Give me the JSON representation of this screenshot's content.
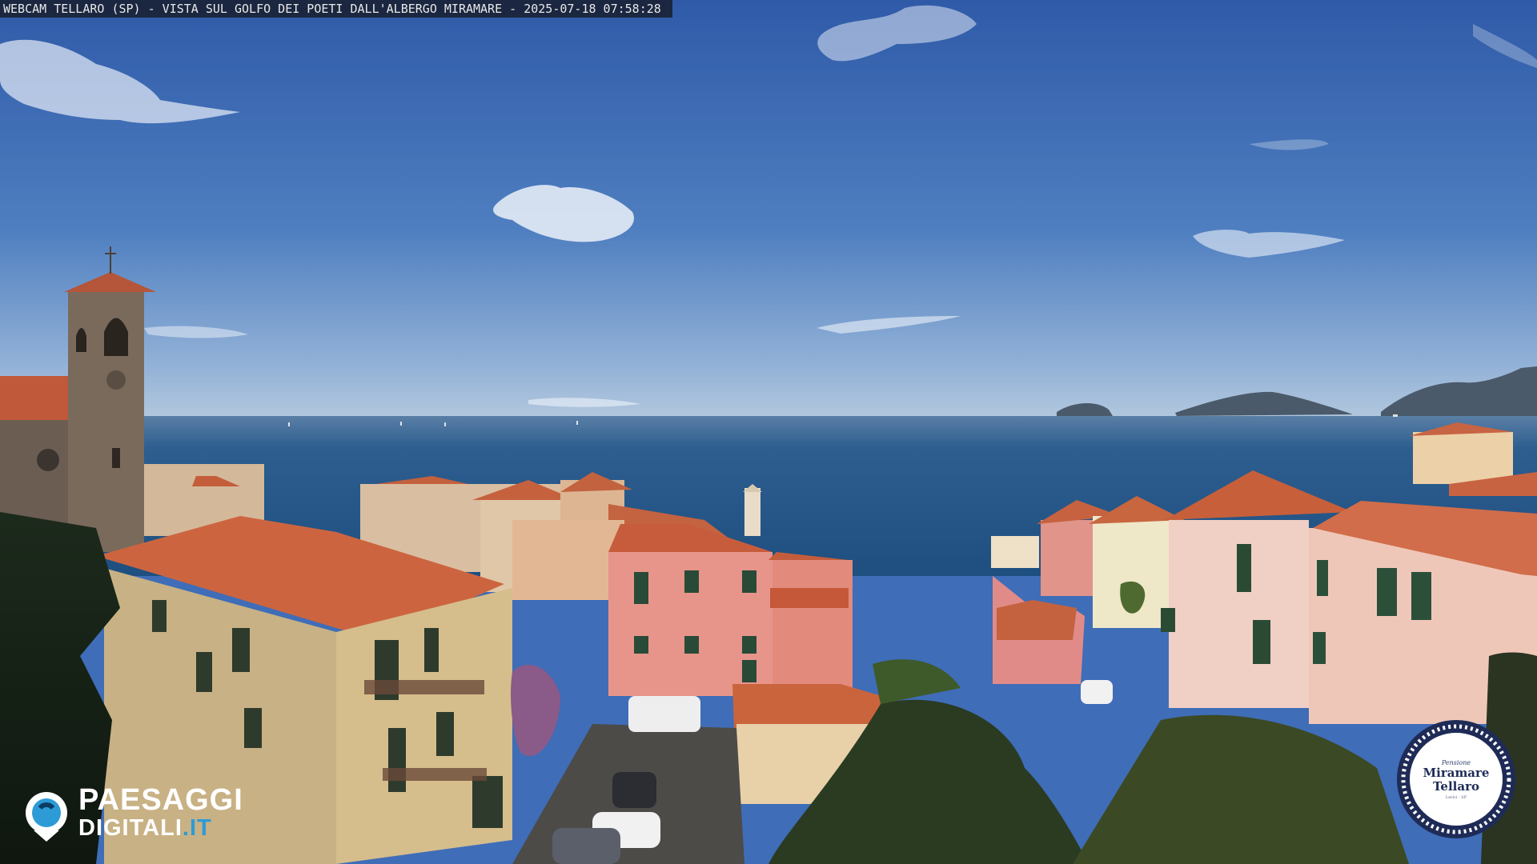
{
  "caption": "WEBCAM TELLARO (SP) - VISTA SUL GOLFO DEI POETI DALL'ALBERGO MIRAMARE - 2025-07-18 07:58:28",
  "watermark": {
    "line1": "PAESAGGI",
    "line2_prefix": "DIGITALI",
    "line2_suffix": ".IT",
    "accent_color": "#2d9bd6"
  },
  "badge": {
    "small_text": "Pensione",
    "line1": "Miramare",
    "line2": "Tellaro",
    "tiny_text": "Lerici · SP",
    "color": "#1f2b57"
  },
  "colors": {
    "sky_top": "#3461b0",
    "sky_horizon": "#a9c2dc",
    "sea": "#2b5e8c",
    "roof": "#c8603e",
    "pink_facade": "#e79a8a",
    "tower_stone": "#6b5f55"
  }
}
